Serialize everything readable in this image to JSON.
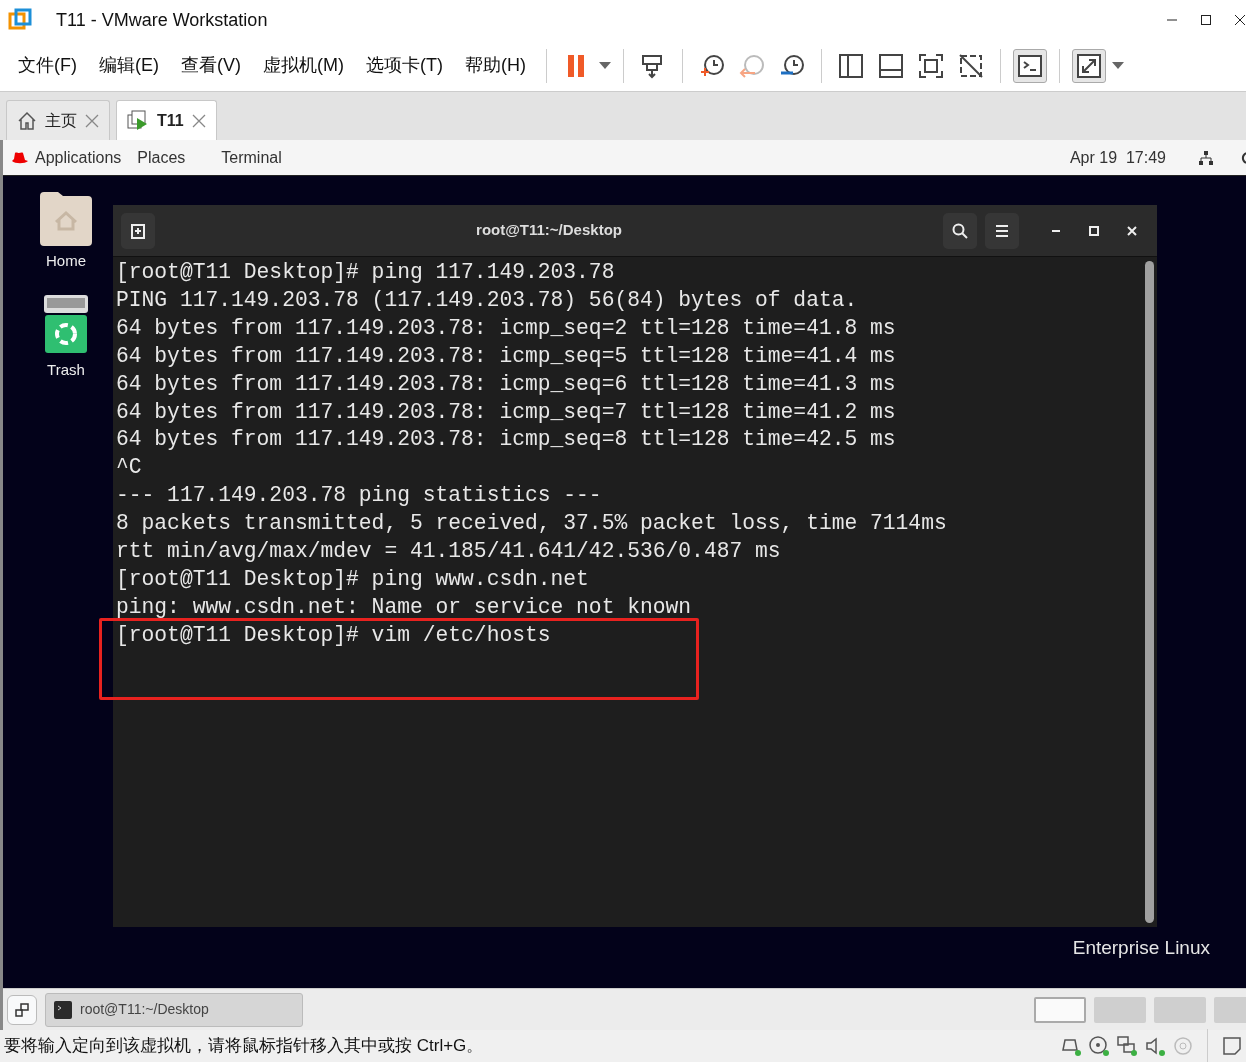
{
  "window": {
    "title": "T11 - VMware Workstation"
  },
  "menu": [
    "文件(F)",
    "编辑(E)",
    "查看(V)",
    "虚拟机(M)",
    "选项卡(T)",
    "帮助(H)"
  ],
  "tabs": [
    {
      "label": "主页",
      "selected": false,
      "kind": "home"
    },
    {
      "label": "T11",
      "selected": true,
      "kind": "vm"
    }
  ],
  "guest_topbar": {
    "items": [
      "Applications",
      "Places",
      "Terminal"
    ],
    "clock": "Apr 19  17:49"
  },
  "desktop_icons": [
    {
      "label": "Home",
      "kind": "folder"
    },
    {
      "label": "Trash",
      "kind": "trash"
    }
  ],
  "terminal": {
    "title": "root@T11:~/Desktop",
    "lines": [
      "[root@T11 Desktop]# ping 117.149.203.78",
      "PING 117.149.203.78 (117.149.203.78) 56(84) bytes of data.",
      "64 bytes from 117.149.203.78: icmp_seq=2 ttl=128 time=41.8 ms",
      "64 bytes from 117.149.203.78: icmp_seq=5 ttl=128 time=41.4 ms",
      "64 bytes from 117.149.203.78: icmp_seq=6 ttl=128 time=41.3 ms",
      "64 bytes from 117.149.203.78: icmp_seq=7 ttl=128 time=41.2 ms",
      "64 bytes from 117.149.203.78: icmp_seq=8 ttl=128 time=42.5 ms",
      "^C",
      "--- 117.149.203.78 ping statistics ---",
      "8 packets transmitted, 5 received, 37.5% packet loss, time 7114ms",
      "rtt min/avg/max/mdev = 41.185/41.641/42.536/0.487 ms",
      "[root@T11 Desktop]# ping www.csdn.net",
      "ping: www.csdn.net: Name or service not known",
      "[root@T11 Desktop]# vim /etc/hosts"
    ],
    "annotation": {
      "kind": "rectangle"
    }
  },
  "brand": "Enterprise Linux",
  "taskbar": {
    "items": [
      "root@T11:~/Desktop"
    ],
    "workspaces": [
      {
        "selected": true
      },
      {
        "selected": false
      },
      {
        "selected": false
      },
      {
        "selected": false
      }
    ]
  },
  "status_bar": {
    "message": "要将输入定向到该虚拟机，请将鼠标指针移入其中或按 Ctrl+G。"
  }
}
